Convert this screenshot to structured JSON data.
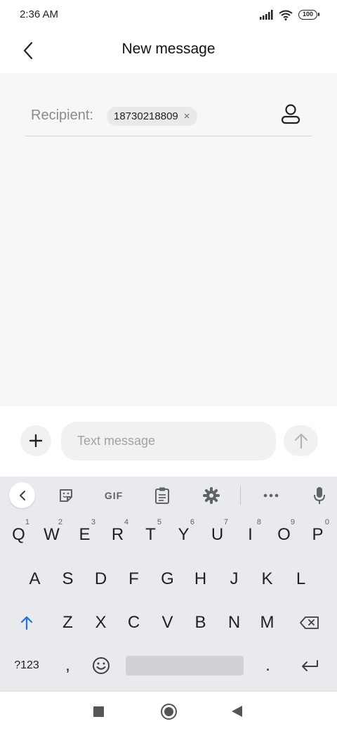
{
  "status_bar": {
    "time": "2:36 AM",
    "battery": "100",
    "icons": [
      "signal-icon",
      "wifi-icon",
      "battery-icon"
    ]
  },
  "header": {
    "title": "New message",
    "back_icon": "chevron-left-icon"
  },
  "recipient": {
    "label": "Recipient:",
    "chip_value": "18730218809",
    "chip_remove": "×",
    "contact_icon": "person-icon"
  },
  "compose": {
    "placeholder": "Text message",
    "attach_icon": "plus-icon",
    "send_icon": "arrow-up-icon"
  },
  "keyboard": {
    "toolbar": {
      "collapse_icon": "chevron-left-icon",
      "sticker_icon": "sticker-icon",
      "gif_label": "GIF",
      "clipboard_icon": "clipboard-icon",
      "settings_icon": "gear-icon",
      "more_icon": "more-horizontal-icon",
      "mic_icon": "mic-icon"
    },
    "row1": [
      {
        "key": "Q",
        "hint": "1"
      },
      {
        "key": "W",
        "hint": "2"
      },
      {
        "key": "E",
        "hint": "3"
      },
      {
        "key": "R",
        "hint": "4"
      },
      {
        "key": "T",
        "hint": "5"
      },
      {
        "key": "Y",
        "hint": "6"
      },
      {
        "key": "U",
        "hint": "7"
      },
      {
        "key": "I",
        "hint": "8"
      },
      {
        "key": "O",
        "hint": "9"
      },
      {
        "key": "P",
        "hint": "0"
      }
    ],
    "row2": [
      "A",
      "S",
      "D",
      "F",
      "G",
      "H",
      "J",
      "K",
      "L"
    ],
    "row3": [
      "Z",
      "X",
      "C",
      "V",
      "B",
      "N",
      "M"
    ],
    "symbols_label": "?123",
    "comma": ",",
    "period": ".",
    "accent_color": "#1a73e8"
  },
  "nav_bar": {
    "recents_icon": "square-icon",
    "home_icon": "circle-icon",
    "back_icon": "triangle-back-icon"
  }
}
